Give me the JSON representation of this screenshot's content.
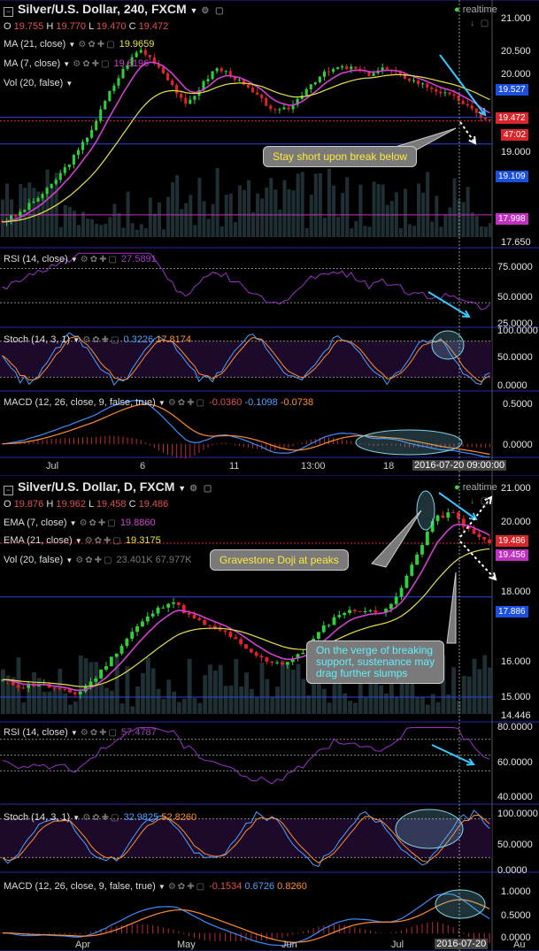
{
  "top_chart": {
    "title": "Silver/U.S. Dollar, 240, FXCM",
    "realtime": "realtime",
    "ohlc": {
      "o_label": "O",
      "o": "19.755",
      "h_label": "H",
      "h": "19.770",
      "l_label": "L",
      "l": "19.470",
      "c_label": "C",
      "c": "19.472"
    },
    "indicators": [
      {
        "label": "MA (21, close)",
        "value": "19.9659",
        "color": "#e8e34a"
      },
      {
        "label": "MA (7, close)",
        "value": "19.8196",
        "color": "#cc44cc"
      },
      {
        "label": "Vol (20, false)",
        "value": "",
        "color": "#888"
      }
    ],
    "price_axis": [
      "21.000",
      "20.500",
      "20.000",
      "19.527",
      "19.472",
      "47:02",
      "19.000",
      "19.109",
      "17.998",
      "17.650"
    ],
    "callout": "Stay short upon break below",
    "rsi": {
      "label": "RSI (14, close)",
      "value": "27.5891",
      "axis": [
        "75.0000",
        "50.0000",
        "25.0000"
      ]
    },
    "stoch": {
      "label": "Stoch (14, 3, 1)",
      "k": "0.3226",
      "d": "17.8174",
      "axis": [
        "100.0000",
        "50.0000",
        "0.0000"
      ]
    },
    "macd": {
      "label": "MACD (12, 26, close, 9, false, true)",
      "v1": "-0.0360",
      "v2": "-0.1098",
      "v3": "-0.0738",
      "axis": [
        "0.5000",
        "0.0000"
      ]
    },
    "time_axis": [
      "Jul",
      "6",
      "11",
      "13:00",
      "18",
      "2016-07-20 09:00:00"
    ]
  },
  "bottom_chart": {
    "title": "Silver/U.S. Dollar, D, FXCM",
    "realtime": "realtime",
    "ohlc": {
      "o_label": "O",
      "o": "19.876",
      "h_label": "H",
      "h": "19.962",
      "l_label": "L",
      "l": "19.458",
      "c_label": "C",
      "c": "19.486"
    },
    "indicators": [
      {
        "label": "EMA (7, close)",
        "value": "19.8860",
        "color": "#cc44cc"
      },
      {
        "label": "EMA (21, close)",
        "value": "19.3175",
        "color": "#e8e34a"
      },
      {
        "label": "Vol (20, false)",
        "value": "23.401K 67.977K",
        "color": "#888"
      }
    ],
    "price_axis": [
      "21.000",
      "20.000",
      "19.486",
      "19.456",
      "18.000",
      "17.886",
      "16.000",
      "15.000",
      "14.446"
    ],
    "callout1": "Gravestone Doji at peaks",
    "callout2_lines": [
      "On the verge of breaking",
      "support, sustenance may",
      "drag further slumps"
    ],
    "rsi": {
      "label": "RSI (14, close)",
      "value": "57.4787",
      "axis": [
        "80.0000",
        "60.0000",
        "40.0000"
      ]
    },
    "stoch": {
      "label": "Stoch (14, 3, 1)",
      "k": "32.9825",
      "d": "52.8260",
      "axis": [
        "100.0000",
        "50.0000",
        "0.0000"
      ]
    },
    "macd": {
      "label": "MACD (12, 26, close, 9, false, true)",
      "v1": "-0.1534",
      "v2": "0.6726",
      "v3": "0.8260",
      "axis": [
        "1.0000",
        "0.5000",
        "0.0000"
      ]
    },
    "time_axis": [
      "Apr",
      "May",
      "Jun",
      "Jul",
      "2016-07-20",
      "Au"
    ]
  },
  "chart_data": [
    {
      "type": "candlestick",
      "title": "Silver/U.S. Dollar, 240, FXCM",
      "ylim": [
        17.65,
        21.2
      ],
      "close_approx": [
        17.9,
        18.0,
        18.2,
        18.4,
        18.7,
        19.0,
        19.4,
        19.9,
        20.3,
        20.6,
        20.4,
        20.1,
        19.7,
        20.0,
        20.3,
        20.2,
        20.0,
        19.8,
        19.6,
        19.7,
        20.0,
        20.2,
        20.3,
        20.3,
        20.2,
        20.3,
        20.2,
        20.1,
        20.0,
        19.9,
        19.8,
        19.6,
        19.47
      ],
      "ma7_color": "#cc44cc",
      "ma21_color": "#e8e34a"
    },
    {
      "type": "candlestick",
      "title": "Silver/U.S. Dollar, D, FXCM",
      "ylim": [
        14.4,
        21.2
      ],
      "close_approx": [
        15.4,
        15.2,
        15.3,
        15.1,
        15.0,
        15.5,
        16.2,
        16.9,
        17.4,
        17.8,
        17.3,
        17.0,
        16.8,
        16.3,
        16.0,
        15.9,
        16.2,
        16.9,
        17.4,
        17.5,
        17.4,
        17.8,
        19.0,
        20.2,
        20.4,
        19.8,
        19.49
      ],
      "ema7_color": "#cc44cc",
      "ema21_color": "#e8e34a"
    }
  ]
}
